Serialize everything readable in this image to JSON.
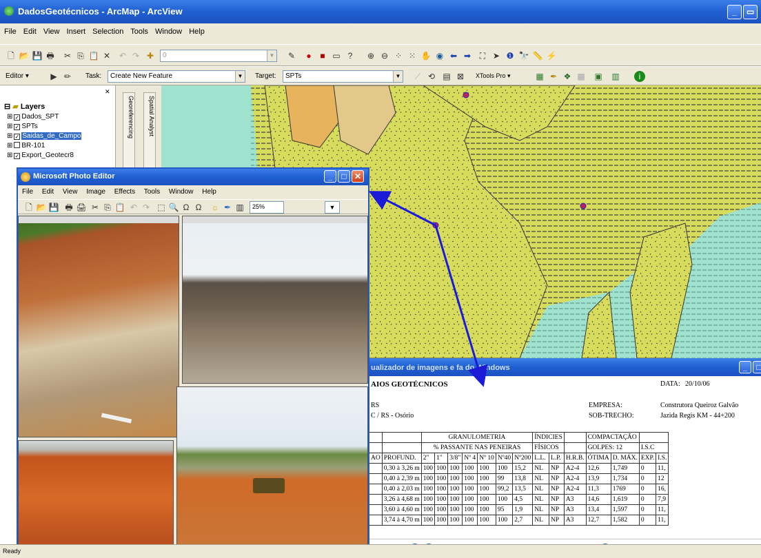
{
  "arcmap": {
    "title": "DadosGeotécnicos - ArcMap - ArcView",
    "menu": [
      "File",
      "Edit",
      "View",
      "Insert",
      "Selection",
      "Tools",
      "Window",
      "Help"
    ],
    "scale_value": "0",
    "editor_label": "Editor",
    "task_label": "Task:",
    "task_value": "Create New Feature",
    "target_label": "Target:",
    "target_value": "SPTs",
    "xtools_label": "XTools Pro",
    "status": "Ready"
  },
  "toc": {
    "root": "Layers",
    "layers": [
      {
        "name": "Dados_SPT",
        "checked": true
      },
      {
        "name": "SPTs",
        "checked": true
      },
      {
        "name": "Saidas_de_Campo",
        "checked": true
      },
      {
        "name": "BR-101",
        "checked": false
      },
      {
        "name": "Export_Geotecr8",
        "checked": true
      }
    ],
    "dock_tabs": [
      "Georeferencing",
      "Spatial Analyst"
    ]
  },
  "photo_editor": {
    "title": "Microsoft Photo Editor",
    "menu": [
      "File",
      "Edit",
      "View",
      "Image",
      "Effects",
      "Tools",
      "Window",
      "Help"
    ],
    "zoom": "25%"
  },
  "viewer": {
    "title": "ualizador de imagens e fa do Windows",
    "doc_title": "AIOS GEOTÉCNICOS",
    "date_label": "DATA:",
    "date_value": "20/10/06",
    "left_line1": "RS",
    "left_line2": "C / RS  -  Osório",
    "empresa_label": "EMPRESA:",
    "empresa_value": "Construtora Queiroz Galvão",
    "subtrecho_label": "SOB-TRECHO:",
    "subtrecho_value": "Jazida Regis  KM - 44+200",
    "headers": {
      "granulometria": "GRANULOMETRIA",
      "passante": "% PASSANTE NAS PENEIRAS",
      "indices": "ÍNDICIES",
      "fisicos": "FÍSICOS",
      "compactacao": "COMPACTAÇÃO",
      "golpes": "GOLPES:  12",
      "isc": "I.S.C",
      "cols": [
        "AO",
        "PROFUND.",
        "2\"",
        "1\"",
        "3/8\"",
        "Nº 4",
        "Nº 10",
        "Nº40",
        "Nº200",
        "L.L.",
        "L.P.",
        "H.R.B.",
        "ÓTIMA",
        "D. MÁX.",
        "EXP.",
        "I.S."
      ]
    },
    "rows": [
      [
        "",
        "0,30 à 3,26 m",
        "100",
        "100",
        "100",
        "100",
        "100",
        "100",
        "15,2",
        "NL",
        "NP",
        "A2-4",
        "12,6",
        "1,749",
        "0",
        "11,"
      ],
      [
        "",
        "0,40 à 2,39 m",
        "100",
        "100",
        "100",
        "100",
        "100",
        "99",
        "13,8",
        "NL",
        "NP",
        "A2-4",
        "13,9",
        "1,734",
        "0",
        "12"
      ],
      [
        "",
        "0,40 à 2,03 m",
        "100",
        "100",
        "100",
        "100",
        "100",
        "99,2",
        "13,5",
        "NL",
        "NP",
        "A2-4",
        "11,3",
        "1769",
        "0",
        "16,"
      ],
      [
        "",
        "3,26 à 4,68 m",
        "100",
        "100",
        "100",
        "100",
        "100",
        "100",
        "4,5",
        "NL",
        "NP",
        "A3",
        "14,6",
        "1,619",
        "0",
        "7,9"
      ],
      [
        "",
        "3,60 à 4,60 m",
        "100",
        "100",
        "100",
        "100",
        "100",
        "95",
        "1,9",
        "NL",
        "NP",
        "A3",
        "13,4",
        "1,597",
        "0",
        "11,"
      ],
      [
        "",
        "3,74 à 4,70 m",
        "100",
        "100",
        "100",
        "100",
        "100",
        "100",
        "2,7",
        "NL",
        "NP",
        "A3",
        "12,7",
        "1,582",
        "0",
        "11,"
      ]
    ]
  },
  "colors": {
    "titlebar": "#1f5fd2",
    "map_soil": "#d8dc5c",
    "map_water": "#9fe3cf",
    "map_orange": "#e7b35c",
    "arrow": "#1a1ad8"
  }
}
